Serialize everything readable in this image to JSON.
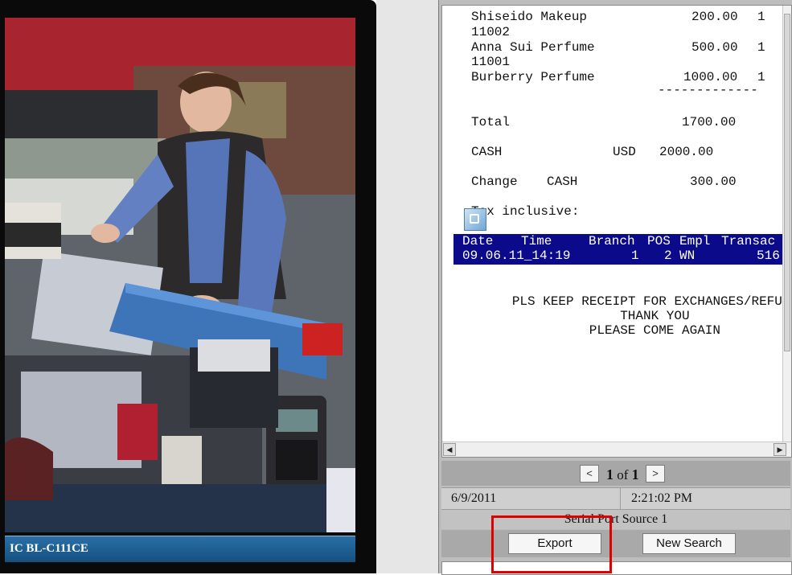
{
  "camera": {
    "caption": "IC BL-C111CE"
  },
  "receipt": {
    "items": [
      {
        "name": "Shiseido Makeup",
        "price": "200.00",
        "qty": "1"
      },
      {
        "code": "11002"
      },
      {
        "name": "Anna Sui Perfume",
        "price": "500.00",
        "qty": "1"
      },
      {
        "code": "11001"
      },
      {
        "name": "Burberry Perfume",
        "price": "1000.00",
        "qty": "1"
      }
    ],
    "separator": "-------------",
    "total_label": "Total",
    "total_value": "1700.00",
    "cash_label": "CASH",
    "cash_currency": "USD",
    "cash_value": "2000.00",
    "change_label": "Change",
    "change_method": "CASH",
    "change_value": "300.00",
    "tax_label": "Tax inclusive:",
    "table_headers": [
      "Date",
      "Time",
      "Branch",
      "POS",
      "Empl",
      "Transac"
    ],
    "table_row": [
      "09.06.11_14:19",
      "1",
      "2",
      "WN",
      "516"
    ],
    "footer_lines": [
      "PLS KEEP RECEIPT FOR EXCHANGES/REFUNDS",
      "THANK YOU",
      "PLEASE COME AGAIN"
    ]
  },
  "pager": {
    "current": "1",
    "of_label": "of",
    "total": "1",
    "prev_icon": "<",
    "next_icon": ">"
  },
  "info": {
    "date": "6/9/2011",
    "time": "2:21:02 PM",
    "source": "Serial Port Source 1"
  },
  "buttons": {
    "export": "Export",
    "new_search": "New Search"
  },
  "colors": {
    "highlight": "#0a0a8a",
    "annotation_box": "#e10000",
    "caption_bar": "#1f5f93"
  }
}
